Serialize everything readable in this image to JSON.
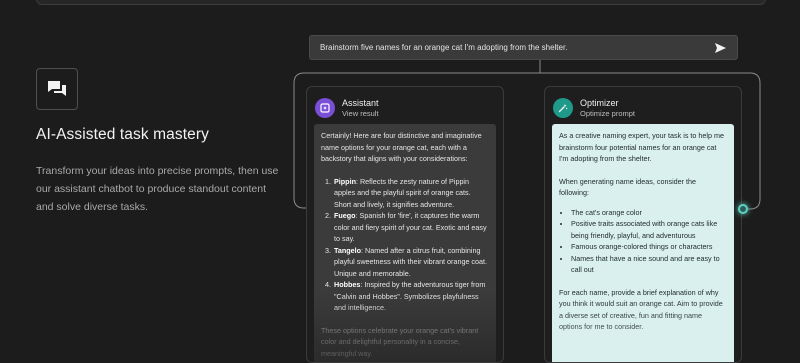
{
  "feature": {
    "icon": "chat-bubbles-icon",
    "title": "AI-Assisted task mastery",
    "description": "Transform your ideas into precise prompts, then use our assistant chatbot to produce standout content and solve diverse tasks."
  },
  "prompt": {
    "text": "Brainstorm five names for an orange cat I'm adopting from the shelter.",
    "send_icon": "send-arrow-icon"
  },
  "assistant": {
    "title": "Assistant",
    "subtitle": "View result",
    "icon": "sparkle-square-icon",
    "intro": "Certainly! Here are four distinctive and imaginative name options for your orange cat, each with a backstory that aligns with your considerations:",
    "items": [
      {
        "name": "Pippin",
        "text": ": Reflects the zesty nature of Pippin apples and the playful spirit of orange cats. Short and lively, it signifies adventure."
      },
      {
        "name": "Fuego",
        "text": ": Spanish for 'fire', it captures the warm color and fiery spirit of your cat. Exotic and easy to say."
      },
      {
        "name": "Tangelo",
        "text": ": Named after a citrus fruit, combining playful sweetness with their vibrant orange coat. Unique and memorable."
      },
      {
        "name": "Hobbes",
        "text": ": Inspired by the adventurous tiger from \"Calvin and Hobbes\". Symbolizes playfulness and intelligence."
      }
    ],
    "outro": "These options celebrate your orange cat's vibrant color and delightful personality in a concise, meaningful way."
  },
  "optimizer": {
    "title": "Optimizer",
    "subtitle": "Optimize prompt",
    "icon": "magic-wand-icon",
    "intro": "As a creative naming expert, your task is to help me brainstorm four potential names for an orange cat I'm adopting from the shelter.",
    "lead": "When generating name ideas, consider the following:",
    "bullets": [
      "The cat's orange color",
      "Positive traits associated with orange cats like being friendly, playful, and adventurous",
      "Famous orange-colored things or characters",
      "Names that have a nice sound and are easy to call out"
    ],
    "outro": "For each name, provide a brief explanation of why you think it would suit an orange cat. Aim to provide a diverse set of creative, fun and fitting name options for me to consider."
  }
}
